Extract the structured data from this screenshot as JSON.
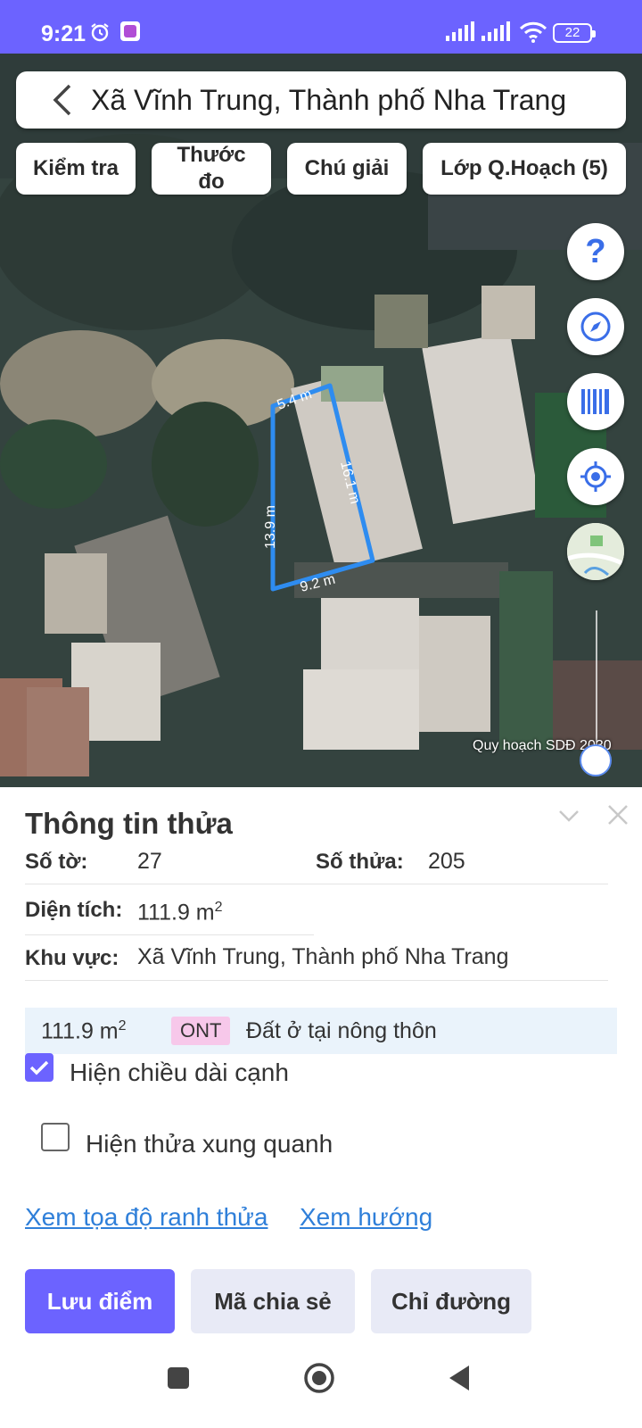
{
  "status_bar": {
    "time": "9:21",
    "battery": "22"
  },
  "header": {
    "title": "Xã Vĩnh Trung, Thành phố Nha Trang"
  },
  "toolbar": {
    "check": "Kiểm tra",
    "measure": "Thước đo",
    "legend": "Chú giải",
    "layers": "Lớp Q.Hoạch (5)"
  },
  "map": {
    "edge_top": "5.4 m",
    "edge_right": "16.1 m",
    "edge_left": "13.9 m",
    "edge_bottom": "9.2 m",
    "layer_caption": "Quy hoạch SDĐ 2030"
  },
  "parcel": {
    "heading": "Thông tin thửa",
    "sheet_label": "Số tờ:",
    "sheet_value": "27",
    "plot_label": "Số thửa:",
    "plot_value": "205",
    "area_label": "Diện tích:",
    "area_value": "111.9 m",
    "area_unit_sup": "2",
    "region_label": "Khu vực:",
    "region_value": "Xã Vĩnh Trung, Thành phố Nha Trang",
    "landuse": {
      "area": "111.9 m",
      "area_sup": "2",
      "code": "ONT",
      "description": "Đất ở tại nông thôn",
      "code_color": "#f7c8ea"
    }
  },
  "options": {
    "show_edge_length": {
      "label": "Hiện chiều dài cạnh",
      "checked": true
    },
    "show_neighbors": {
      "label": "Hiện thửa xung quanh",
      "checked": false
    }
  },
  "links": {
    "coords": "Xem tọa độ ranh thửa",
    "direction": "Xem hướng"
  },
  "actions": {
    "save": "Lưu điểm",
    "share": "Mã chia sẻ",
    "directions": "Chỉ đường"
  },
  "colors": {
    "accent": "#6c63ff",
    "parcel_outline": "#2e8cf0",
    "link": "#2f7fd9"
  },
  "icons": [
    "back-icon",
    "help-icon",
    "compass-icon",
    "barcode-icon",
    "locate-icon",
    "basemap-icon",
    "collapse-icon",
    "close-icon",
    "square-nav-icon",
    "home-nav-icon",
    "back-nav-icon"
  ]
}
